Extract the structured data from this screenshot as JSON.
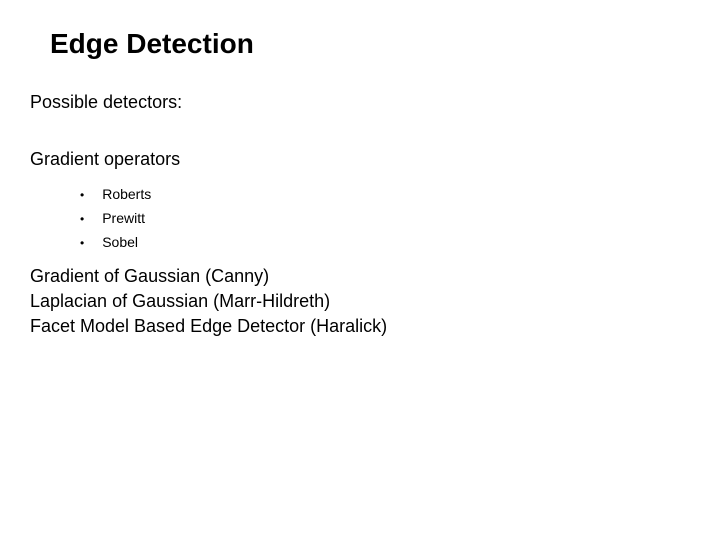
{
  "title": "Edge Detection",
  "section_label": "Possible detectors:",
  "subsection": "Gradient operators",
  "bullets": {
    "b0": "Roberts",
    "b1": "Prewitt",
    "b2": "Sobel"
  },
  "lines": {
    "l0": "Gradient of Gaussian (Canny)",
    "l1": "Laplacian of Gaussian (Marr-Hildreth)",
    "l2": "Facet Model Based Edge Detector (Haralick)"
  }
}
